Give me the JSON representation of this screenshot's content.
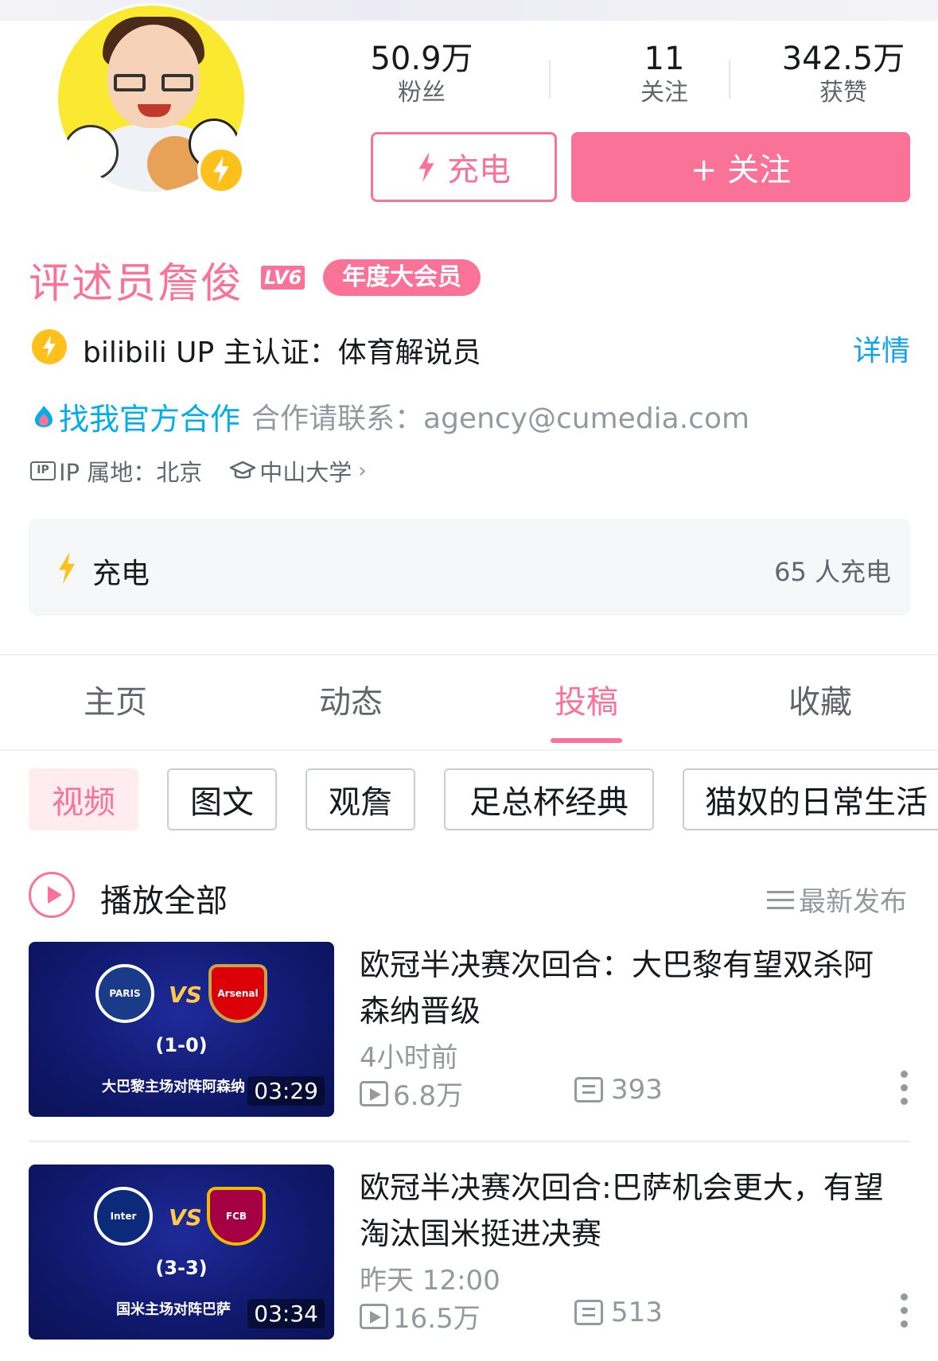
{
  "profile": {
    "username": "评述员詹俊",
    "level_badge": "LV6",
    "vip_badge": "年度大会员",
    "certification": "bilibili UP 主认证：体育解说员",
    "cert_detail_link": "详情",
    "coop_link": "找我官方合作",
    "coop_text": "合作请联系：agency@cumedia.com",
    "ip_label": "IP 属地：北京",
    "school": "中山大学",
    "ip_icon_text": "IP"
  },
  "stats": [
    {
      "value": "50.9万",
      "label": "粉丝"
    },
    {
      "value": "11",
      "label": "关注"
    },
    {
      "value": "342.5万",
      "label": "获赞"
    }
  ],
  "actions": {
    "charge_label": "充电",
    "follow_label": "+ 关注"
  },
  "charge_card": {
    "label": "充电",
    "count": "65 人充电"
  },
  "tabs": [
    {
      "label": "主页",
      "active": false
    },
    {
      "label": "动态",
      "active": false
    },
    {
      "label": "投稿",
      "active": true
    },
    {
      "label": "收藏",
      "active": false
    }
  ],
  "chips": [
    {
      "label": "视频",
      "active": true
    },
    {
      "label": "图文",
      "active": false
    },
    {
      "label": "观詹",
      "active": false
    },
    {
      "label": "足总杯经典",
      "active": false
    },
    {
      "label": "猫奴的日常生活",
      "active": false
    }
  ],
  "playlist": {
    "play_all": "播放全部",
    "sort": "最新发布"
  },
  "videos": [
    {
      "title": "欧冠半决赛次回合：大巴黎有望双杀阿森纳晋级",
      "time": "4小时前",
      "plays": "6.8万",
      "comments": "393",
      "thumb": {
        "home": "PARIS",
        "away": "Arsenal",
        "vs": "VS",
        "score": "(1-0)",
        "caption": "大巴黎主场对阵阿森纳",
        "duration": "03:29"
      }
    },
    {
      "title": "欧冠半决赛次回合:巴萨机会更大，有望淘汰国米挺进决赛",
      "time": "昨天 12:00",
      "plays": "16.5万",
      "comments": "513",
      "thumb": {
        "home": "Inter",
        "away": "FCB",
        "vs": "VS",
        "score": "(3-3)",
        "caption": "国米主场对阵巴萨",
        "duration": "03:34"
      }
    }
  ],
  "colors": {
    "accent_pink": "#fb7299",
    "link_blue": "#00aeec",
    "bolt_yellow": "#ffc01c",
    "thumb_navy": "#101a6f"
  }
}
